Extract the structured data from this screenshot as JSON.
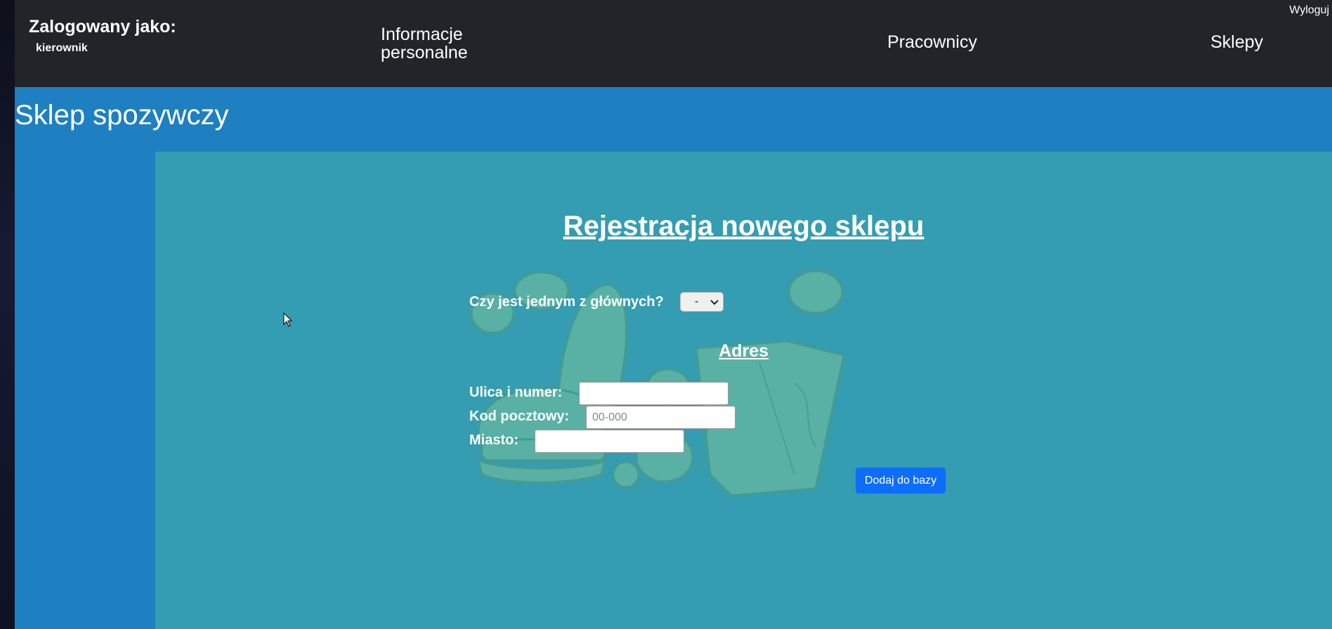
{
  "navbar": {
    "logged_in_label": "Zalogowany jako:",
    "username": "kierownik",
    "links": [
      "Informacje personalne",
      "Pracownicy",
      "Sklepy"
    ],
    "logout": "Wyloguj"
  },
  "shop": {
    "name": "Sklep spozywczy"
  },
  "form": {
    "heading": "Rejestracja nowego sklepu",
    "main_question": "Czy jest jednym z głównych?",
    "main_select_value": "-",
    "address_heading": "Adres",
    "street_label": "Ulica i numer:",
    "street_value": "",
    "postal_label": "Kod pocztowy:",
    "postal_placeholder": "00-000",
    "city_label": "Miasto:",
    "city_value": "",
    "submit_label": "Dodaj do bazy"
  },
  "icons": [
    "chevron-down-icon",
    "mouse-cursor-icon",
    "food-illustration"
  ],
  "colors": {
    "navbar_bg": "#212428",
    "page_bg": "#1e80c0",
    "content_bg": "#349db1",
    "button_bg": "#0d6efd"
  }
}
